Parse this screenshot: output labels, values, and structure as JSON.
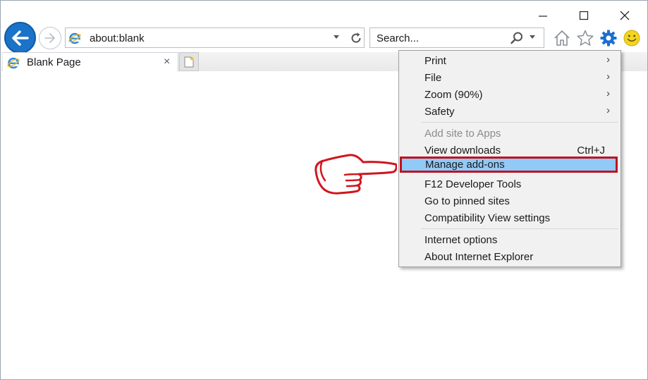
{
  "window": {
    "controls": [
      "minimize",
      "maximize",
      "close"
    ]
  },
  "navigation": {
    "back_icon": "back-arrow-icon",
    "forward_icon": "forward-arrow-icon"
  },
  "address_bar": {
    "url": "about:blank",
    "site_icon": "internet-explorer-icon"
  },
  "search": {
    "placeholder": "Search..."
  },
  "toolbar_icons": [
    "home-icon",
    "favorites-star-icon",
    "tools-gear-icon",
    "feedback-smiley-icon"
  ],
  "tab": {
    "title": "Blank Page",
    "close": "×"
  },
  "menu": {
    "items": [
      {
        "label": "Print",
        "submenu": true
      },
      {
        "label": "File",
        "submenu": true
      },
      {
        "label": "Zoom (90%)",
        "submenu": true
      },
      {
        "label": "Safety",
        "submenu": true
      },
      {
        "label": "Add site to Apps",
        "disabled": true
      },
      {
        "label": "View downloads",
        "shortcut": "Ctrl+J"
      },
      {
        "label": "Manage add-ons",
        "highlighted": true
      },
      {
        "label": "F12 Developer Tools"
      },
      {
        "label": "Go to pinned sites"
      },
      {
        "label": "Compatibility View settings"
      },
      {
        "label": "Internet options"
      },
      {
        "label": "About Internet Explorer"
      }
    ],
    "submenu_glyph": "›"
  },
  "colors": {
    "back_button": "#1b73c9",
    "menu_background": "#f1f1f1",
    "highlight": "#91c9f7",
    "highlight_border": "#c1111d",
    "pointer_hand": "#d0161f",
    "gear": "#1c6fd0",
    "smiley": "#f3d41f"
  }
}
